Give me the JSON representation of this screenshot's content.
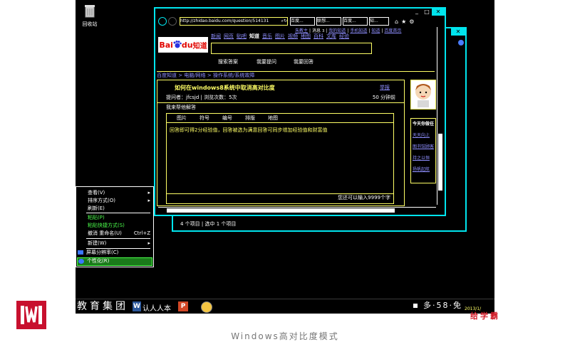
{
  "desktop": {
    "recycle_bin_label": "回收站"
  },
  "context_menu": {
    "items": [
      {
        "label": "查看(V)",
        "arrow": "▸"
      },
      {
        "label": "排序方式(O)",
        "arrow": "▸"
      },
      {
        "label": "刷新(E)"
      },
      {
        "label": "粘贴(P)"
      },
      {
        "label": "粘贴快捷方式(S)"
      },
      {
        "label": "撤消 重命名(U)",
        "shortcut": "Ctrl+Z"
      },
      {
        "label": "新建(W)",
        "arrow": "▸"
      },
      {
        "label": "屏幕分辨率(C)"
      },
      {
        "label": "个性化(R)"
      }
    ]
  },
  "explorer_back": {
    "status": "4 个项目 | 选中 1 个项目",
    "controls": [
      "✕"
    ]
  },
  "browser": {
    "url": "http://zhidao.baidu.com/question/514131",
    "tabs": [
      "百度...",
      "联想...",
      "百度...",
      "知..."
    ],
    "window_controls": [
      "_",
      "□",
      "✕"
    ],
    "nav_icons": [
      "⌂",
      "★",
      "⚙"
    ],
    "baidu": {
      "logo_part1": "Bai",
      "logo_part2": "du",
      "logo_part3": "知道",
      "top_nav": [
        "新闻",
        "网页",
        "贴吧",
        "知道",
        "音乐",
        "图片",
        "视频",
        "地图",
        "百科",
        "文库",
        "经验"
      ],
      "top_right": [
        "朱教主",
        "|",
        "消息",
        "3",
        "|",
        "我的知道",
        "|",
        "手机知道",
        "|",
        "知道",
        "|",
        "百度首页"
      ],
      "buttons": [
        "搜索答案",
        "我要提问",
        "我要回答"
      ],
      "breadcrumb": "百度知道 > 电脑/网络 > 操作系统/系统故障",
      "question_title": "如何在windows8系统中取消高对比度",
      "report_label": "举报",
      "asker_line": "提问者：jfcsjd | 浏览次数：5次",
      "points": "50 分钟前",
      "help_label": "我来帮他解答",
      "editor_tools": [
        "图片",
        "符号",
        "编号",
        "排版",
        "地图"
      ],
      "editor_text": "回答即可得2分经验值，回答被选为满意回答可同步增加经验值和财富值",
      "char_hint": "您还可以输入9999个字",
      "side_title": "今天你做任",
      "side_items": [
        "天天向上",
        "图书馆顾客",
        "持之以恒",
        "扬帆起航"
      ]
    }
  },
  "taskbar": {
    "overlay_title": "教育集团",
    "app_label": "认人人本",
    "tray_text": "多·58·免",
    "clock": "2013/1/"
  },
  "branding": {
    "caption": "Windows高对比度模式",
    "mark": "给学霸"
  }
}
